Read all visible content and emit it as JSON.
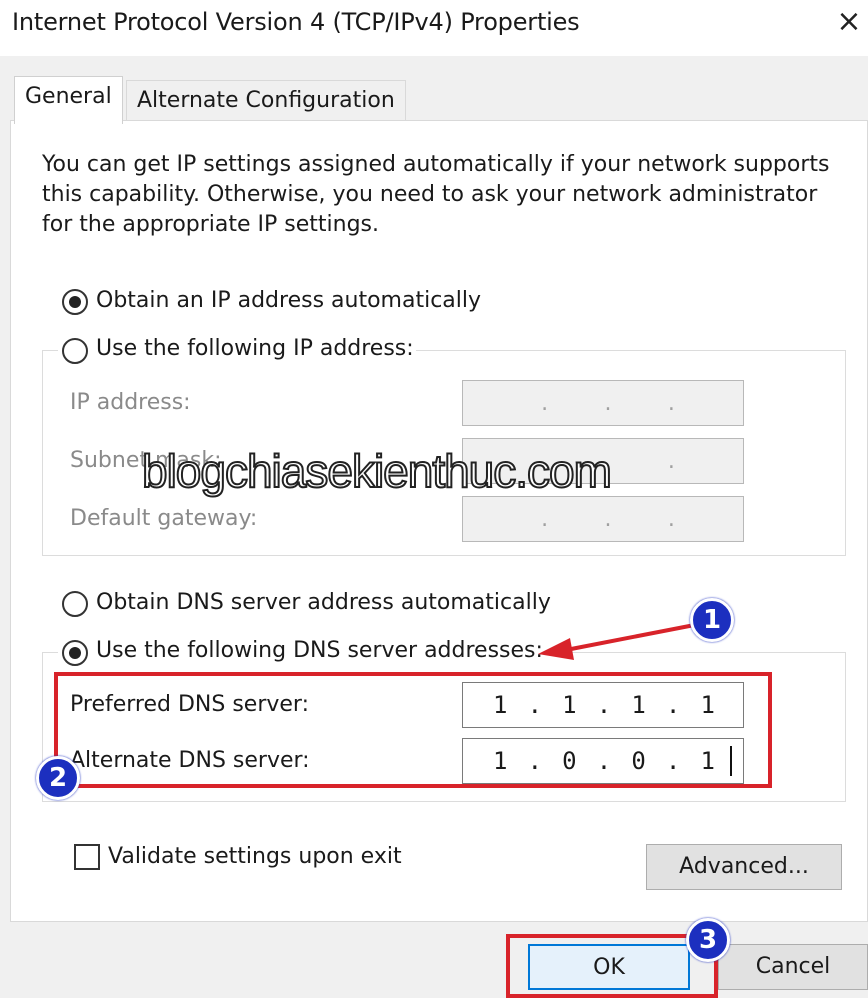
{
  "window": {
    "title": "Internet Protocol Version 4 (TCP/IPv4) Properties",
    "close_glyph": "×"
  },
  "tabs": [
    {
      "label": "General",
      "selected": true
    },
    {
      "label": "Alternate Configuration",
      "selected": false
    }
  ],
  "intro": {
    "text": "You can get IP settings assigned automatically if your network supports this capability. Otherwise, you need to ask your network administrator for the appropriate IP settings."
  },
  "ip": {
    "auto_label": "Obtain an IP address automatically",
    "auto_selected": true,
    "manual_label": "Use the following IP address:",
    "manual_selected": false,
    "fields": [
      {
        "label": "IP address:",
        "value": ". . ."
      },
      {
        "label": "Subnet mask:",
        "value": ". . ."
      },
      {
        "label": "Default gateway:",
        "value": ". . ."
      }
    ]
  },
  "dns": {
    "auto_label": "Obtain DNS server address automatically",
    "auto_selected": false,
    "manual_label": "Use the following DNS server addresses:",
    "manual_selected": true,
    "preferred": {
      "label": "Preferred DNS server:",
      "octets": [
        "1",
        ".",
        "1",
        ".",
        "1",
        ".",
        "1"
      ]
    },
    "alternate": {
      "label": "Alternate DNS server:",
      "octets": [
        "1",
        ".",
        "0",
        ".",
        "0",
        ".",
        "1"
      ]
    }
  },
  "validate": {
    "label": "Validate settings upon exit",
    "checked": false
  },
  "buttons": {
    "advanced": "Advanced...",
    "ok": "OK",
    "cancel": "Cancel"
  },
  "annotations": {
    "badge_1": "1",
    "badge_2": "2",
    "badge_3": "3",
    "watermark": "blogchiasekienthuc.com",
    "accent_red": "#d8232a",
    "badge_blue": "#1c2fbf"
  }
}
